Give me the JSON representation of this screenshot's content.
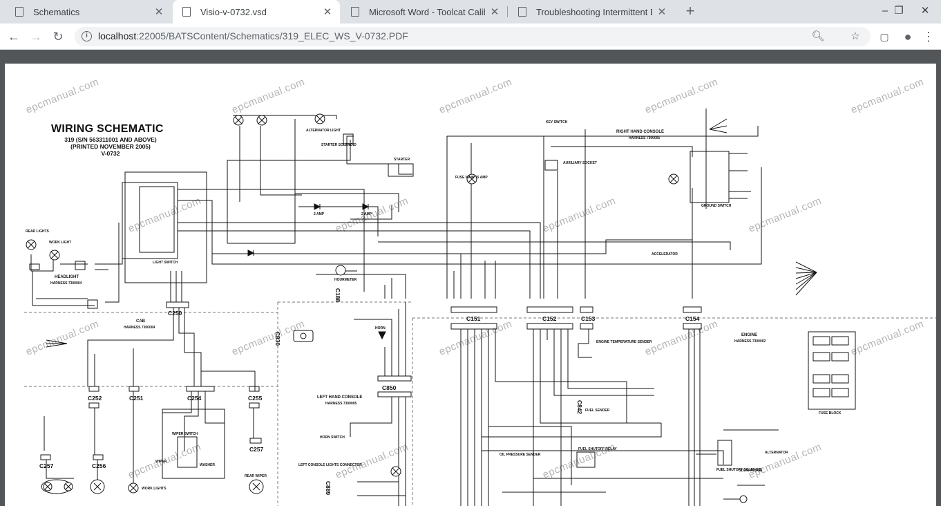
{
  "browser": {
    "tabs": [
      {
        "title": "Schematics",
        "active": false
      },
      {
        "title": "Visio-v-0732.vsd",
        "active": true
      },
      {
        "title": "Microsoft Word - Toolcat Calibrat",
        "active": false
      },
      {
        "title": "Troubleshooting Intermittent Elec",
        "active": false
      }
    ],
    "new_tab": "+",
    "window_controls": {
      "minimize": "–",
      "maximize": "❐",
      "close": "✕"
    },
    "nav": {
      "back": "←",
      "forward": "→",
      "reload": "↻"
    },
    "address": {
      "host": "localhost",
      "path": ":22005/BATSContent/Schematics/319_ELEC_WS_V-0732.PDF"
    }
  },
  "document": {
    "title": "WIRING SCHEMATIC",
    "subtitle_lines": [
      "319 (S/N 563311001 AND ABOVE)",
      "(PRINTED NOVEMBER 2005)",
      "V-0732"
    ],
    "watermark": "epcmanual.com",
    "sections": {
      "headlight": "HEADLIGHT",
      "headlight_harness": "HARNESS 7300004",
      "cab": "CAB",
      "cab_harness": "HARNESS 7300004",
      "right_hand_console": "RIGHT HAND CONSOLE",
      "rhc_harness": "HARNESS 7300005",
      "left_hand_console": "LEFT HAND CONSOLE",
      "lhc_harness": "HARNESS 7300005",
      "engine": "ENGINE",
      "engine_harness": "HARNESS 7300002",
      "fuse_block": "FUSE BLOCK",
      "fuel_shutoff_relay": "FUEL SHUTOFF RELAY",
      "ground_switch": "GROUND SWITCH",
      "light_switch": "LIGHT SWITCH",
      "wiper_switch": "WIPER SWITCH",
      "washer": "WASHER",
      "wiper": "WIPER",
      "rear_wiper": "REAR WIPER",
      "work_lights": "WORK LIGHTS",
      "rear_lights": "REAR LIGHTS",
      "work_light": "WORK LIGHT",
      "alternator_light": "ALTERNATOR LIGHT",
      "starter": "STARTER",
      "starter_solenoid": "STARTER SOLENOID",
      "key_switch": "KEY SWITCH",
      "auxiliary_socket": "AUXILIARY SOCKET",
      "fuse_main": "FUSE MAIN 15 AMP",
      "hourmeter": "HOURMETER",
      "accelerator": "ACCELERATOR",
      "horn": "HORN",
      "horn_switch": "HORN SWITCH",
      "oil_pressure_sender": "OIL PRESSURE SENDER",
      "temp_sender": "ENGINE TEMPERATURE SENDER",
      "fuel_sender": "FUEL SENDER",
      "fuel_shutoff_solenoid": "FUEL SHUTOFF SOLENOID",
      "glow_plugs": "GLOW PLUGS",
      "alternator": "ALTERNATOR",
      "left_console_lights_connector": "LEFT CONSOLE LIGHTS CONNECTOR",
      "diode_a": "2 AMP",
      "diode_b": "2 AMP"
    },
    "connectors": [
      "C250",
      "C151",
      "C152",
      "C153",
      "C154",
      "C252",
      "C251",
      "C254",
      "C255",
      "C257",
      "C256",
      "C850",
      "C257"
    ],
    "vertical_connectors": [
      "C188",
      "C830",
      "C889",
      "C842"
    ]
  }
}
